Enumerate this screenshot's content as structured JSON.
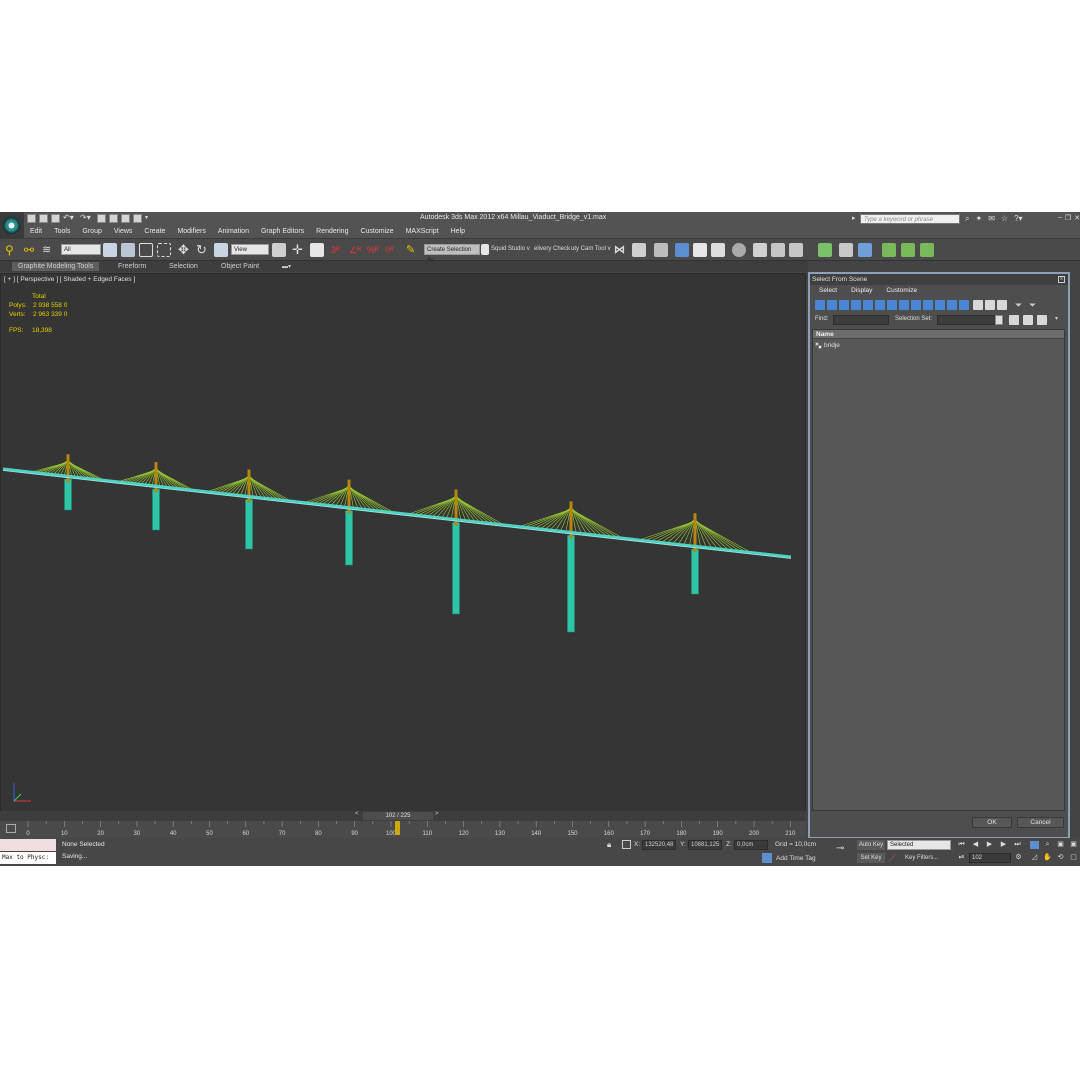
{
  "app": {
    "title": "Autodesk 3ds Max  2012 x64      Millau_Viaduct_Bridge_v1.max",
    "search_placeholder": "Type a keyword or phrase",
    "menu": [
      "Edit",
      "Tools",
      "Group",
      "Views",
      "Create",
      "Modifiers",
      "Animation",
      "Graph Editors",
      "Rendering",
      "Customize",
      "MAXScript",
      "Help"
    ]
  },
  "toolbar": {
    "selection_filter": "All",
    "reference_coord": "View",
    "named_selection": "Create Selection Se",
    "text_items": [
      "Squid Studio v",
      "elivery Check",
      "uty Cam Tool v"
    ]
  },
  "ribbon": {
    "tabs": [
      "Graphite Modeling Tools",
      "Freeform",
      "Selection",
      "Object Paint"
    ]
  },
  "viewport": {
    "label": "[ + ] [ Perspective ] [ Shaded + Edged Faces ]",
    "stats": {
      "header": "Total",
      "polys_label": "Polys:",
      "polys_value": "2 938 558   0",
      "verts_label": "Verts:",
      "verts_value": "2 963 339   0",
      "fps_label": "FPS:",
      "fps_value": "18,398"
    },
    "colors": {
      "background": "#353535",
      "deck": "#4fd1c5",
      "pylon": "#b8860b",
      "cables": "#9acd32",
      "piers": "#2ec4a6"
    }
  },
  "dialog": {
    "title": "Select From Scene",
    "menu": [
      "Select",
      "Display",
      "Customize"
    ],
    "find_label": "Find:",
    "selection_set_label": "Selection Set:",
    "column_name": "Name",
    "objects": [
      "bridje"
    ],
    "ok_label": "OK",
    "cancel_label": "Cancel"
  },
  "timeline": {
    "frame_display": "102 / 225",
    "ticks": [
      "0",
      "10",
      "20",
      "30",
      "40",
      "50",
      "60",
      "70",
      "80",
      "90",
      "100",
      "110",
      "120",
      "130",
      "140",
      "150",
      "160",
      "170",
      "180",
      "190",
      "200",
      "210"
    ]
  },
  "status": {
    "maxscript_text": "Max to Physc:",
    "selection_status": "None Selected",
    "prompt": "Saving...",
    "x_label": "X:",
    "x_value": "132520,48",
    "y_label": "Y:",
    "y_value": "10881,125",
    "z_label": "Z:",
    "z_value": "0,0cm",
    "grid": "Grid = 10,0cm",
    "add_time_tag": "Add Time Tag",
    "auto_key": "Auto Key",
    "set_key": "Set Key",
    "key_mode": "Selected",
    "key_filters": "Key Filters...",
    "current_frame": "102"
  }
}
